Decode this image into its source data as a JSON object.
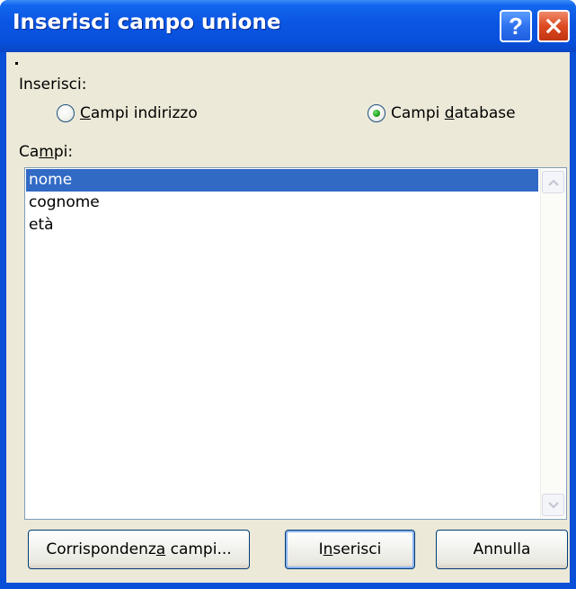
{
  "dialog": {
    "title": "Inserisci campo unione",
    "help_label": "?"
  },
  "insert_group": {
    "label": "Inserisci:",
    "options": [
      {
        "label_underline": "C",
        "label_rest": "ampi indirizzo",
        "selected": false
      },
      {
        "label_before": "Campi ",
        "label_underline": "d",
        "label_rest": "atabase",
        "selected": true
      }
    ]
  },
  "fields": {
    "label_before": "Ca",
    "label_underline": "m",
    "label_rest": "pi:",
    "items": [
      "nome",
      "cognome",
      "età"
    ],
    "selected_index": 0
  },
  "buttons": {
    "match_before": "Corrispondenza campi...",
    "match_label_before": "Corrispondenz",
    "match_label_underline": "a",
    "match_label_rest": " campi...",
    "insert_before": "I",
    "insert_underline": "n",
    "insert_rest": "serisci",
    "cancel_label": "Annulla"
  },
  "colors": {
    "titlebar": "#0a55e2",
    "selection": "#316ac5",
    "dialog_bg": "#ece9d8",
    "radio_selected": "#21a121"
  }
}
